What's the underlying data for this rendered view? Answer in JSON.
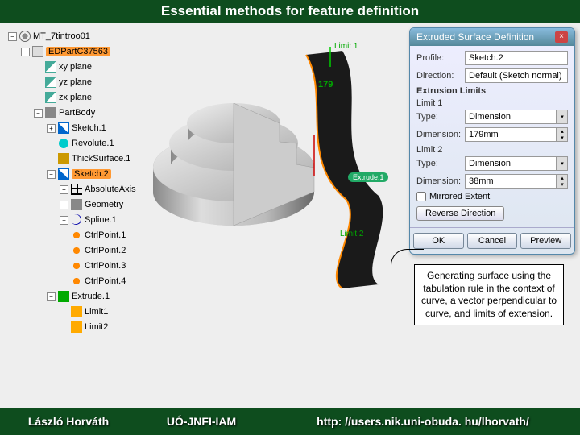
{
  "title": "Essential methods for feature definition",
  "tree": {
    "root": "MT_7tintroo01",
    "items": [
      {
        "label": "EDPartC37563",
        "icon": "ico-cube",
        "ind": 1,
        "hl": true,
        "exp": "−"
      },
      {
        "label": "xy plane",
        "icon": "ico-plane",
        "ind": 2
      },
      {
        "label": "yz plane",
        "icon": "ico-plane",
        "ind": 2
      },
      {
        "label": "zx plane",
        "icon": "ico-plane",
        "ind": 2
      },
      {
        "label": "PartBody",
        "icon": "ico-body",
        "ind": 2,
        "exp": "−"
      },
      {
        "label": "Sketch.1",
        "icon": "ico-sketch",
        "ind": 3,
        "exp": "+"
      },
      {
        "label": "Revolute.1",
        "icon": "ico-rev",
        "ind": 3
      },
      {
        "label": "ThickSurface.1",
        "icon": "ico-surf",
        "ind": 3
      },
      {
        "label": "Sketch.2",
        "icon": "ico-sketch",
        "ind": 3,
        "hl": true,
        "exp": "−"
      },
      {
        "label": "AbsoluteAxis",
        "icon": "ico-axis",
        "ind": 4,
        "exp": "+"
      },
      {
        "label": "Geometry",
        "icon": "ico-body",
        "ind": 4,
        "exp": "−"
      },
      {
        "label": "Spline.1",
        "icon": "spline",
        "ind": 4,
        "exp": "−"
      },
      {
        "label": "CtrlPoint.1",
        "icon": "ico-pt",
        "ind": 4
      },
      {
        "label": "CtrlPoint.2",
        "icon": "ico-pt",
        "ind": 4
      },
      {
        "label": "CtrlPoint.3",
        "icon": "ico-pt",
        "ind": 4
      },
      {
        "label": "CtrlPoint.4",
        "icon": "ico-pt",
        "ind": 4
      },
      {
        "label": "Extrude.1",
        "icon": "ico-ext",
        "ind": 3,
        "exp": "−"
      },
      {
        "label": "Limit1",
        "icon": "ico-lim",
        "ind": 4
      },
      {
        "label": "Limit2",
        "icon": "ico-lim",
        "ind": 4
      }
    ]
  },
  "viewport": {
    "label_top": "Limit 1",
    "label_dim": "179",
    "label_bottom": "Limit 2",
    "label_surface": "Extrude.1"
  },
  "dialog": {
    "title": "Extruded Surface Definition",
    "profile_lab": "Profile:",
    "profile_val": "Sketch.2",
    "direction_lab": "Direction:",
    "direction_val": "Default (Sketch normal)",
    "limits_header": "Extrusion Limits",
    "limit1": "Limit 1",
    "limit2": "Limit 2",
    "type_lab": "Type:",
    "type_val": "Dimension",
    "dim_lab": "Dimension:",
    "dim_val1": "179mm",
    "dim_val2": "38mm",
    "mirrored": "Mirrored Extent",
    "reverse": "Reverse Direction",
    "ok": "OK",
    "cancel": "Cancel",
    "preview": "Preview"
  },
  "callout": "Generating surface using the tabulation rule in the context of curve, a vector perpendicular to curve, and limits of extension.",
  "footer": {
    "author": "László Horváth",
    "org": "UÓ-JNFI-IAM",
    "url": "http: //users.nik.uni-obuda. hu/lhorvath/"
  }
}
